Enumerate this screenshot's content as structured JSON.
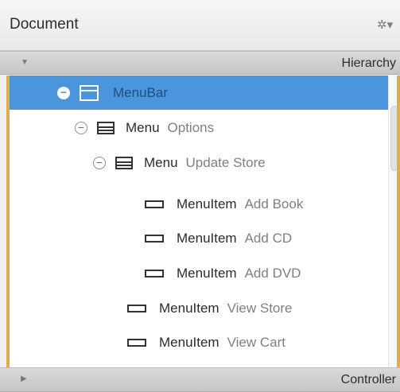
{
  "document": {
    "title": "Document"
  },
  "sections": {
    "hierarchy_label": "Hierarchy",
    "controller_label": "Controller"
  },
  "icons": {
    "gear": "gear-icon",
    "collapse": "minus-circle-icon",
    "menubar": "window-icon",
    "menu": "menu-icon",
    "menuitem": "menuitem-icon"
  },
  "tree": {
    "rows": [
      {
        "type": "MenuBar",
        "name": "",
        "selected": true
      },
      {
        "type": "Menu",
        "name": "Options"
      },
      {
        "type": "Menu",
        "name": "Update Store"
      },
      {
        "type": "MenuItem",
        "name": "Add Book"
      },
      {
        "type": "MenuItem",
        "name": "Add CD"
      },
      {
        "type": "MenuItem",
        "name": "Add DVD"
      },
      {
        "type": "MenuItem",
        "name": "View Store"
      },
      {
        "type": "MenuItem",
        "name": "View Cart"
      }
    ]
  },
  "colors": {
    "selection": "#4b95dc",
    "accent_border": "#e3ab4f"
  }
}
